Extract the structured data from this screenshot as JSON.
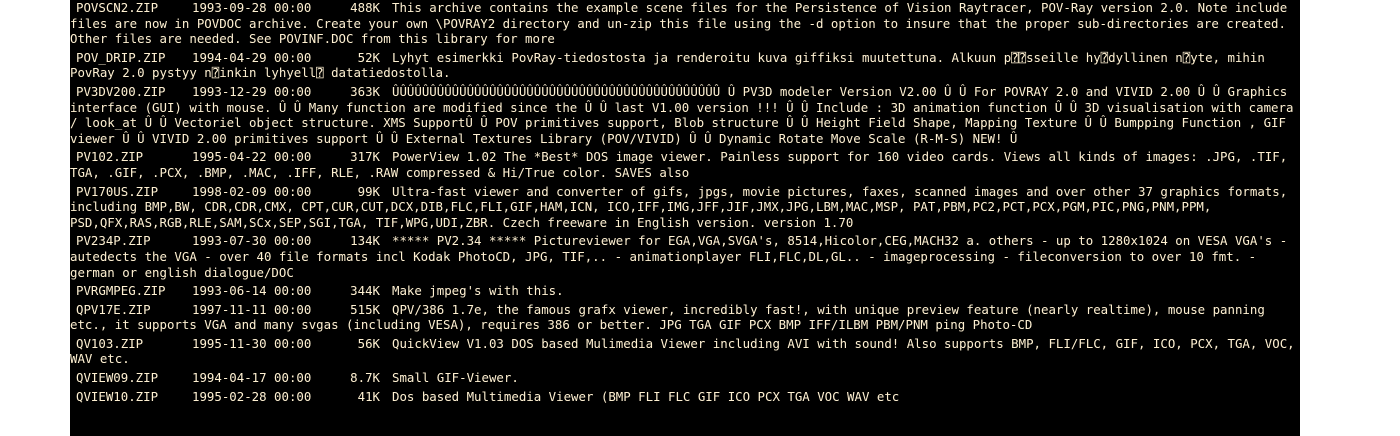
{
  "colors": {
    "background": "#000000",
    "text": "#fff1d2",
    "page": "#ffffff"
  },
  "files": [
    {
      "name": "POVSCN2.ZIP",
      "date": "1993-09-28 00:00",
      "size": "488K",
      "description": "This archive contains the example scene files for the Persistence of Vision Raytracer, POV-Ray version 2.0. Note include files are now in POVDOC archive. Create your own \\POVRAY2 directory and un-zip this file using the -d option to insure that the proper sub-directories are created. Other files are needed. See POVINF.DOC from this library for more"
    },
    {
      "name": "POV_DRIP.ZIP",
      "date": "1994-04-29 00:00",
      "size": "52K",
      "description": "Lyhyt esimerkki PovRay-tiedostosta ja renderoitu kuva giffiksi muutettuna. Alkuun p⍰⍰sseille hy⍰dyllinen n⍰yte, mihin PovRay 2.0 pystyy n⍰inkin lyhyell⍰ datatiedostolla."
    },
    {
      "name": "PV3DV200.ZIP",
      "date": "1993-12-29 00:00",
      "size": "363K",
      "description": "ÛÛÛÛÛÛÛÛÛÛÛÛÛÛÛÛÛÛÛÛÛÛÛÛÛÛÛÛÛÛÛÛÛÛÛÛÛÛÛÛÛÛÛÛ Û PV3D modeler Version V2.00 Û Û For POVRAY 2.0 and VIVID 2.00 Û Û Graphics interface (GUI) with mouse. Û Û Many function are modified since the Û Û last V1.00 version !!! Û Û Include : 3D animation function Û Û 3D visualisation with camera / look_at Û Û Vectoriel object structure. XMS SupportÛ Û POV primitives support, Blob structure Û Û Height Field Shape, Mapping Texture Û Û Bumpping Function , GIF viewer Û Û VIVID 2.00 primitives support Û Û External Textures Library (POV/VIVID) Û Û Dynamic Rotate Move Scale (R-M-S) NEW! Û"
    },
    {
      "name": "PV102.ZIP",
      "date": "1995-04-22 00:00",
      "size": "317K",
      "description": "PowerView 1.02 The *Best* DOS image viewer. Painless support for 160 video cards. Views all kinds of images: .JPG, .TIF, TGA, .GIF, .PCX, .BMP, .MAC, .IFF, RLE, .RAW compressed & Hi/True color. SAVES also"
    },
    {
      "name": "PV170US.ZIP",
      "date": "1998-02-09 00:00",
      "size": "99K",
      "description": "Ultra-fast viewer and converter of gifs, jpgs, movie pictures, faxes, scanned images and over other 37 graphics formats, including BMP,BW, CDR,CDR,CMX, CPT,CUR,CUT,DCX,DIB,FLC,FLI,GIF,HAM,ICN, ICO,IFF,IMG,JFF,JIF,JMX,JPG,LBM,MAC,MSP, PAT,PBM,PC2,PCT,PCX,PGM,PIC,PNG,PNM,PPM, PSD,QFX,RAS,RGB,RLE,SAM,SCx,SEP,SGI,TGA, TIF,WPG,UDI,ZBR. Czech freeware in English version. version 1.70"
    },
    {
      "name": "PV234P.ZIP",
      "date": "1993-07-30 00:00",
      "size": "134K",
      "description": "***** PV2.34 ***** Pictureviewer for EGA,VGA,SVGA's, 8514,Hicolor,CEG,MACH32 a. others - up to 1280x1024 on VESA VGA's - autedects the VGA - over 40 file formats incl Kodak PhotoCD, JPG, TIF,.. - animationplayer FLI,FLC,DL,GL.. - imageprocessing - fileconversion to over 10 fmt. - german or english dialogue/DOC"
    },
    {
      "name": "PVRGMPEG.ZIP",
      "date": "1993-06-14 00:00",
      "size": "344K",
      "description": "Make jmpeg's with this."
    },
    {
      "name": "QPV17E.ZIP",
      "date": "1997-11-11 00:00",
      "size": "515K",
      "description": "QPV/386 1.7e, the famous grafx viewer, incredibly fast!, with unique preview feature (nearly realtime), mouse panning etc., it supports VGA and many svgas (including VESA), requires 386 or better. JPG TGA GIF PCX BMP IFF/ILBM PBM/PNM ping Photo-CD"
    },
    {
      "name": "QV103.ZIP",
      "date": "1995-11-30 00:00",
      "size": "56K",
      "description": "QuickView V1.03 DOS based Mulimedia Viewer including AVI with sound! Also supports BMP, FLI/FLC, GIF, ICO, PCX, TGA, VOC, WAV etc."
    },
    {
      "name": "QVIEW09.ZIP",
      "date": "1994-04-17 00:00",
      "size": "8.7K",
      "description": "Small GIF-Viewer."
    },
    {
      "name": "QVIEW10.ZIP",
      "date": "1995-02-28 00:00",
      "size": "41K",
      "description": "Dos based Multimedia Viewer (BMP FLI FLC GIF ICO PCX TGA VOC WAV etc"
    }
  ]
}
